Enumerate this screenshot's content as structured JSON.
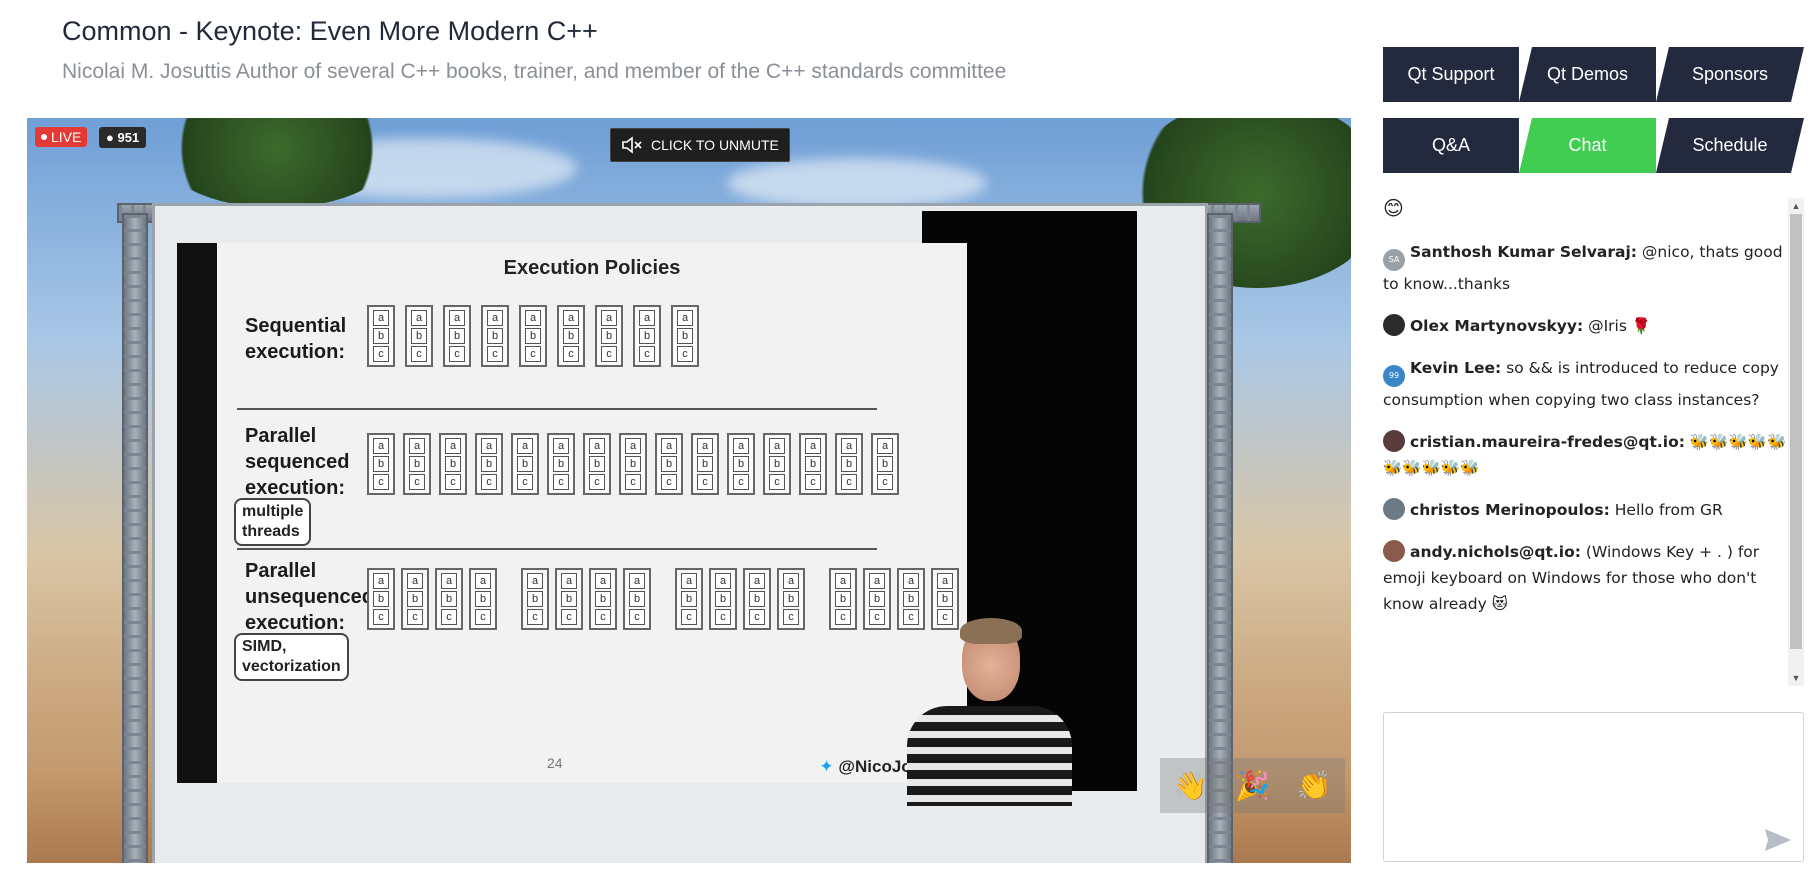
{
  "header": {
    "title": "Common - Keynote: Even More Modern C++",
    "subtitle": "Nicolai M. Josuttis Author of several C++ books, trainer, and member of the C++ standards committee"
  },
  "video": {
    "live_label": "LIVE",
    "viewer_count": "951",
    "unmute_label": "CLICK TO UNMUTE",
    "slide": {
      "title": "Execution Policies",
      "sections": [
        {
          "label_lines": [
            "Sequential",
            "execution:"
          ]
        },
        {
          "label_lines": [
            "Parallel",
            "sequenced",
            "execution:"
          ],
          "note_lines": [
            "multiple",
            "threads"
          ]
        },
        {
          "label_lines": [
            "Parallel",
            "unsequenced",
            "execution:"
          ],
          "note_lines": [
            "SIMD,",
            "vectorization"
          ]
        }
      ],
      "cell_letters": [
        "a",
        "b",
        "c"
      ],
      "page_number": "24",
      "handle": "@NicoJosuttis"
    },
    "reactions": [
      "👋",
      "🎉",
      "👏"
    ]
  },
  "tabs": {
    "row1": [
      "Qt Support",
      "Qt Demos",
      "Sponsors"
    ],
    "row2": [
      "Q&A",
      "Chat",
      "Schedule"
    ],
    "active": "Chat"
  },
  "colors": {
    "tab_bg": "#242a3d",
    "tab_active_bg": "#41cd52",
    "live_red": "#e53935"
  },
  "chat": {
    "messages": [
      {
        "author": "",
        "text": "😊",
        "avatar_icon": ""
      },
      {
        "author": "Santhosh Kumar Selvaraj:",
        "text": " @nico, thats good to know...thanks",
        "avatar_text": "SA",
        "avatar_color": "#9aa1a6"
      },
      {
        "author": "Olex Martynovskyy:",
        "text": " @Iris 🌹",
        "avatar_text": "",
        "avatar_color": "#2b2b2b"
      },
      {
        "author": "Kevin Lee:",
        "text": " so && is introduced to reduce copy consumption when copying two class instances?",
        "avatar_text": "99",
        "avatar_color": "#3a86c8"
      },
      {
        "author": "cristian.maureira-fredes@qt.io:",
        "text": " 🐝🐝🐝🐝🐝🐝🐝🐝🐝🐝",
        "avatar_text": "",
        "avatar_color": "#5a3b3b"
      },
      {
        "author": "christos Merinopoulos:",
        "text": " Hello from GR",
        "avatar_text": "",
        "avatar_color": "#6b7a84"
      },
      {
        "author": "andy.nichols@qt.io:",
        "text": " (Windows Key + . ) for emoji keyboard on Windows for those who don't know already 😻",
        "avatar_text": "",
        "avatar_color": "#8a5a4a"
      }
    ],
    "input_value": ""
  }
}
